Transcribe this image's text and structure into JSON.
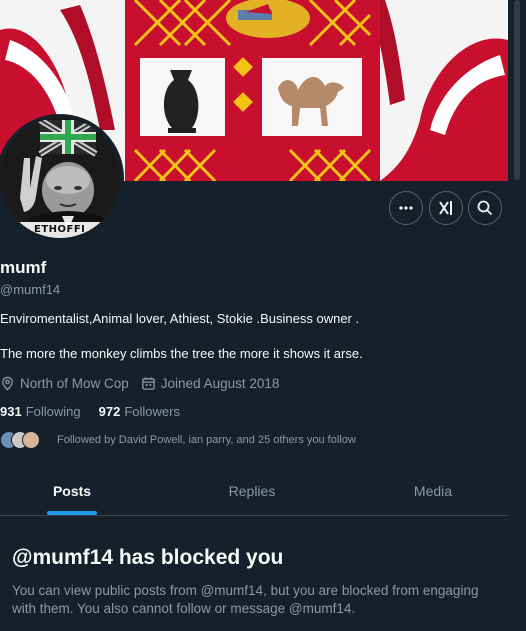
{
  "profile": {
    "name": "mumf",
    "handle": "@mumf14",
    "bio_line1": "Enviromentalist,Animal lover, Athiest, Stokie .Business owner .",
    "bio_line2": "The more the monkey climbs the tree the more it shows it arse.",
    "location": "North of Mow Cop",
    "joined": "Joined August 2018",
    "following_count": "931",
    "following_label": "Following",
    "followers_count": "972",
    "followers_label": "Followers",
    "followed_by": "Followed by David Powell, ian parry, and 25 others you follow",
    "avatar_text": "ETHOFFI"
  },
  "actions": [
    {
      "icon": "more-icon"
    },
    {
      "icon": "grok-icon"
    },
    {
      "icon": "search-icon"
    }
  ],
  "tabs": [
    {
      "label": "Posts",
      "active": true
    },
    {
      "label": "Replies",
      "active": false
    },
    {
      "label": "Media",
      "active": false
    }
  ],
  "blocked": {
    "title": "@mumf14 has blocked you",
    "message": "You can view public posts from @mumf14, but you are blocked from engaging with them. You also cannot follow or message @mumf14."
  },
  "colors": {
    "background": "#15202b",
    "accent": "#1d9bf0",
    "muted_text": "#8b98a5",
    "banner_red": "#c8102e"
  }
}
